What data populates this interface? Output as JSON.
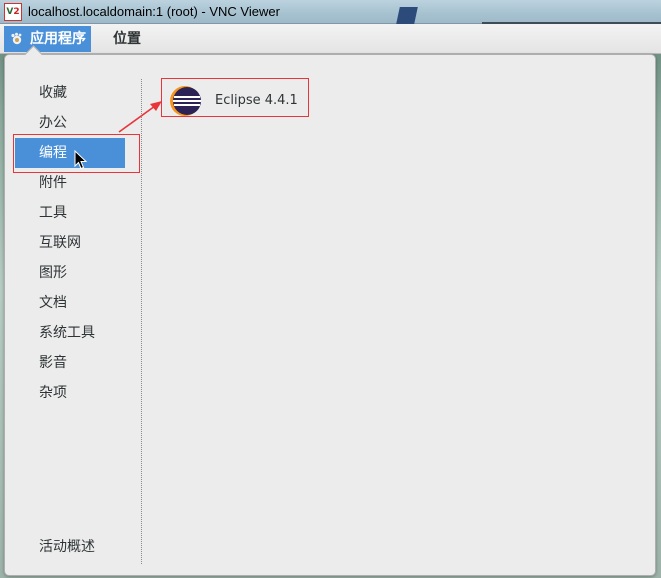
{
  "window": {
    "title": "localhost.localdomain:1 (root) - VNC Viewer",
    "icon": "vnc-viewer-icon"
  },
  "panel": {
    "applications_label": "应用程序",
    "places_label": "位置"
  },
  "menu": {
    "categories": [
      {
        "label": "收藏"
      },
      {
        "label": "办公"
      },
      {
        "label": "编程",
        "selected": true
      },
      {
        "label": "附件"
      },
      {
        "label": "工具"
      },
      {
        "label": "互联网"
      },
      {
        "label": "图形"
      },
      {
        "label": "文档"
      },
      {
        "label": "系统工具"
      },
      {
        "label": "影音"
      },
      {
        "label": "杂项"
      }
    ],
    "activities_label": "活动概述",
    "apps": [
      {
        "label": "Eclipse 4.4.1",
        "icon": "eclipse-icon"
      }
    ]
  },
  "colors": {
    "selection": "#4a90d9",
    "annotation": "#e8343b",
    "menu_bg": "#ececec"
  }
}
